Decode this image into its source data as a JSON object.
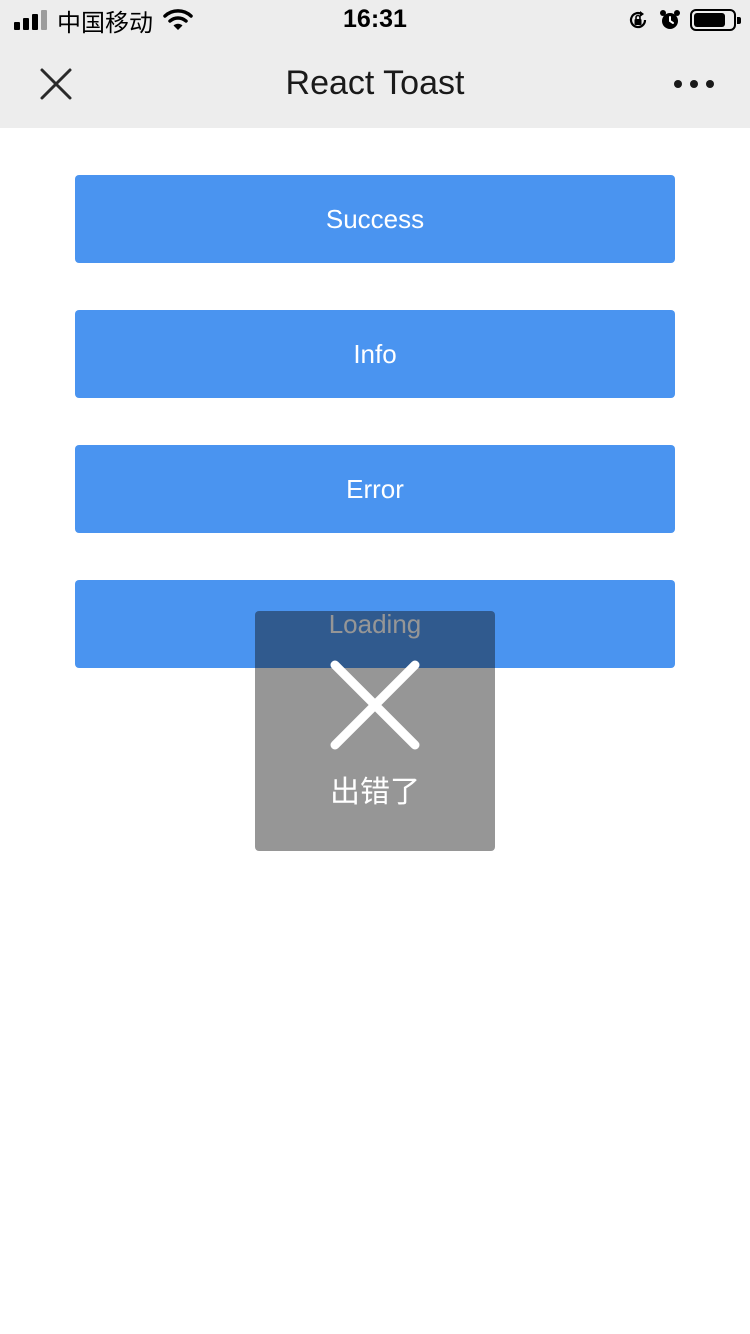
{
  "status_bar": {
    "carrier": "中国移动",
    "time": "16:31",
    "icons": [
      "signal-icon",
      "wifi-icon",
      "rotation-lock-icon",
      "alarm-icon",
      "battery-icon"
    ]
  },
  "nav": {
    "title": "React Toast",
    "close_icon": "close-icon",
    "more_icon": "more-icon"
  },
  "buttons": {
    "success": "Success",
    "info": "Info",
    "error": "Error",
    "loading": "Loading"
  },
  "toast": {
    "icon": "error-x-icon",
    "text": "出错了"
  },
  "colors": {
    "accent": "#4a94f0",
    "bar_bg": "#ededed",
    "toast_bg": "rgba(17,17,17,0.44)"
  }
}
